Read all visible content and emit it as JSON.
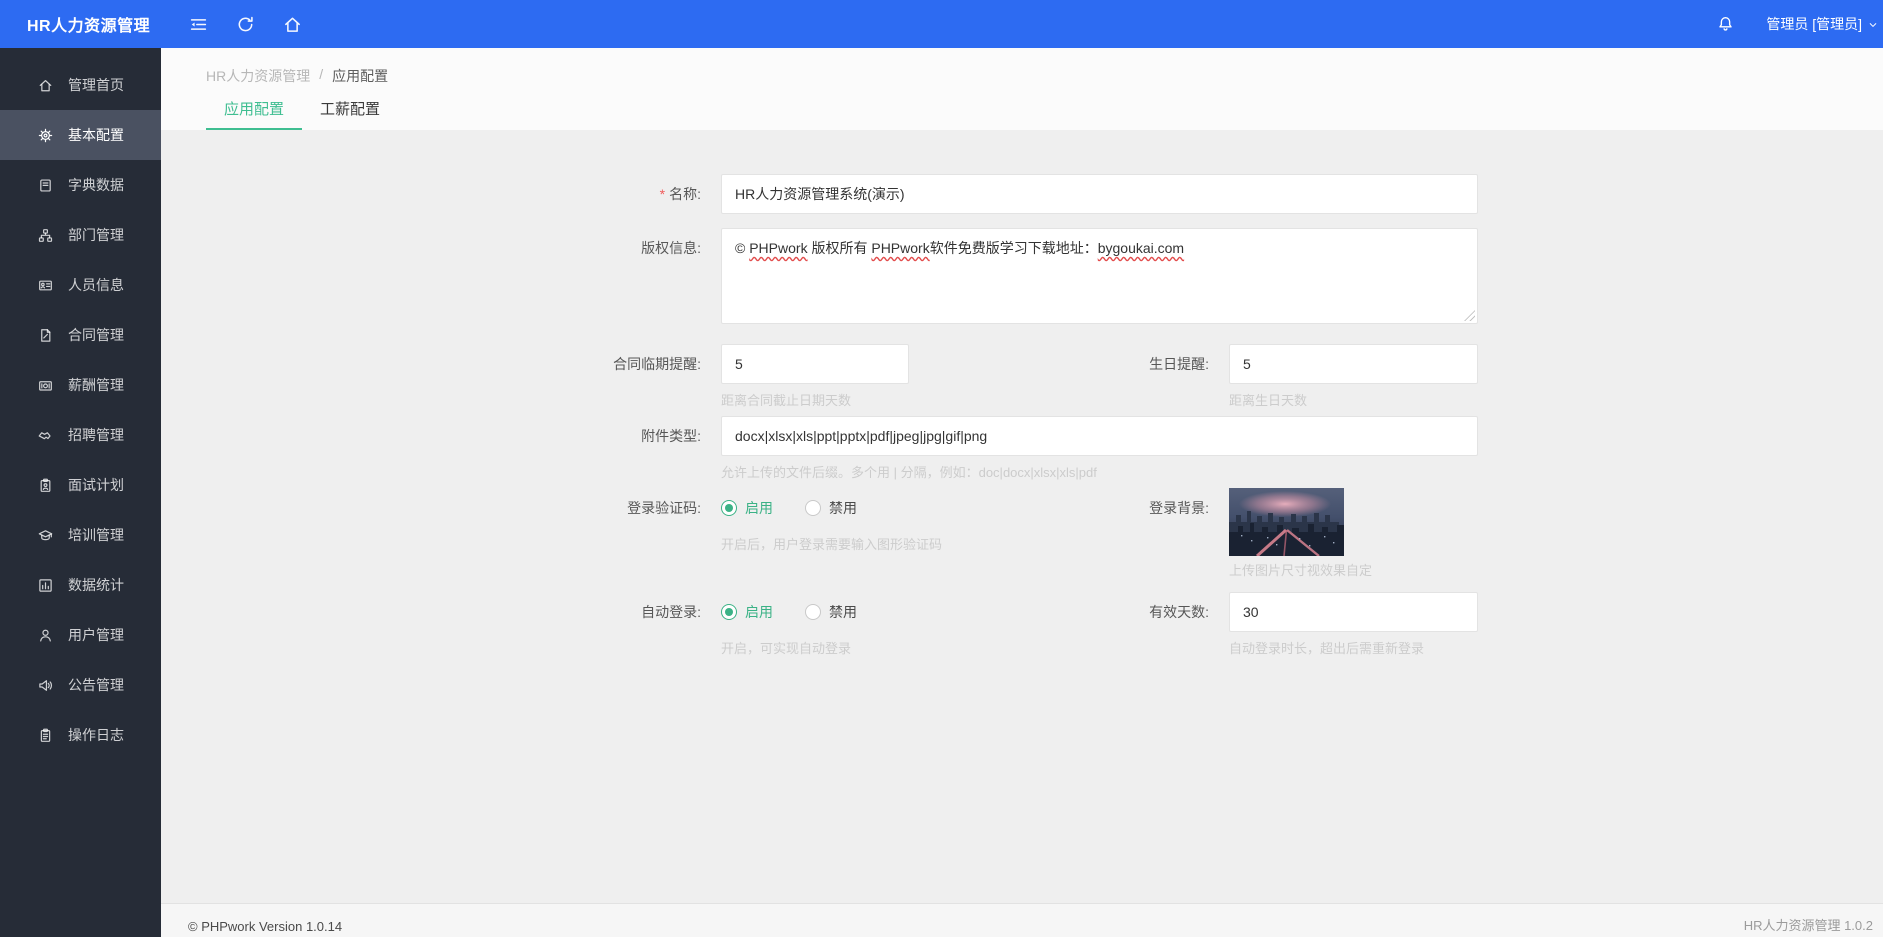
{
  "colors": {
    "header_blue": "#2d6bf2",
    "sidebar_dark": "#262c37",
    "sidebar_active": "#4a5161",
    "accent_green": "#3fbe91",
    "radio_green": "#3bb286",
    "wavy_red": "#e24c4c",
    "required_red": "#f05b5b"
  },
  "header": {
    "app_title": "HR人力资源管理",
    "icons": {
      "collapse": "collapse-icon",
      "refresh": "refresh-icon",
      "home": "home-icon",
      "bell": "bell-icon",
      "chevron": "chevron-down-icon"
    },
    "user": "管理员 [管理员]"
  },
  "sidebar": {
    "items": [
      {
        "key": "home",
        "label": "管理首页",
        "icon": "home-icon",
        "active": false
      },
      {
        "key": "basic-config",
        "label": "基本配置",
        "icon": "gear-icon",
        "active": true
      },
      {
        "key": "dictionary",
        "label": "字典数据",
        "icon": "book-icon",
        "active": false
      },
      {
        "key": "department",
        "label": "部门管理",
        "icon": "sitemap-icon",
        "active": false
      },
      {
        "key": "personnel",
        "label": "人员信息",
        "icon": "id-card-icon",
        "active": false
      },
      {
        "key": "contract",
        "label": "合同管理",
        "icon": "file-sign-icon",
        "active": false
      },
      {
        "key": "salary",
        "label": "薪酬管理",
        "icon": "money-icon",
        "active": false
      },
      {
        "key": "recruitment",
        "label": "招聘管理",
        "icon": "handshake-icon",
        "active": false
      },
      {
        "key": "interview",
        "label": "面试计划",
        "icon": "clipboard-user-icon",
        "active": false
      },
      {
        "key": "training",
        "label": "培训管理",
        "icon": "graduation-cap-icon",
        "active": false
      },
      {
        "key": "statistics",
        "label": "数据统计",
        "icon": "bar-chart-icon",
        "active": false
      },
      {
        "key": "users",
        "label": "用户管理",
        "icon": "user-icon",
        "active": false
      },
      {
        "key": "announcement",
        "label": "公告管理",
        "icon": "speaker-icon",
        "active": false
      },
      {
        "key": "logs",
        "label": "操作日志",
        "icon": "clipboard-icon",
        "active": false
      }
    ]
  },
  "breadcrumb": {
    "root": "HR人力资源管理",
    "separator": "/",
    "current": "应用配置"
  },
  "tabs": [
    {
      "key": "app-config",
      "label": "应用配置",
      "active": true
    },
    {
      "key": "salary-config",
      "label": "工薪配置",
      "active": false
    }
  ],
  "form": {
    "name": {
      "required_mark": "*",
      "label": "名称:",
      "value": "HR人力资源管理系统(演示)"
    },
    "copyright": {
      "label": "版权信息:",
      "value": "© PHPwork 版权所有 PHPwork软件免费版学习下载地址：bygoukai.com",
      "segments": [
        {
          "text": "© ",
          "wavy": false
        },
        {
          "text": "PHPwork",
          "wavy": true
        },
        {
          "text": " 版权所有 ",
          "wavy": false
        },
        {
          "text": "PHPwork",
          "wavy": true
        },
        {
          "text": "软件免费版学习下载地址：",
          "wavy": false
        },
        {
          "text": "bygoukai.com",
          "wavy": true
        }
      ]
    },
    "contract_reminder": {
      "label": "合同临期提醒:",
      "value": "5",
      "hint": "距离合同截止日期天数"
    },
    "birthday_reminder": {
      "label": "生日提醒:",
      "value": "5",
      "hint": "距离生日天数"
    },
    "attachment_types": {
      "label": "附件类型:",
      "value": "docx|xlsx|xls|ppt|pptx|pdf|jpeg|jpg|gif|png",
      "hint": "允许上传的文件后缀。多个用 | 分隔，例如：doc|docx|xlsx|xls|pdf"
    },
    "login_captcha": {
      "label": "登录验证码:",
      "options": [
        {
          "label": "启用",
          "selected": true
        },
        {
          "label": "禁用",
          "selected": false
        }
      ],
      "hint": "开启后，用户登录需要输入图形验证码"
    },
    "login_background": {
      "label": "登录背景:",
      "image": "city-dusk-photo",
      "hint": "上传图片尺寸视效果自定"
    },
    "auto_login": {
      "label": "自动登录:",
      "options": [
        {
          "label": "启用",
          "selected": true
        },
        {
          "label": "禁用",
          "selected": false
        }
      ],
      "hint": "开启，可实现自动登录"
    },
    "valid_days": {
      "label": "有效天数:",
      "value": "30",
      "hint": "自动登录时长，超出后需重新登录"
    }
  },
  "footer": {
    "left": "© PHPwork Version 1.0.14",
    "right": "HR人力资源管理 1.0.2"
  }
}
